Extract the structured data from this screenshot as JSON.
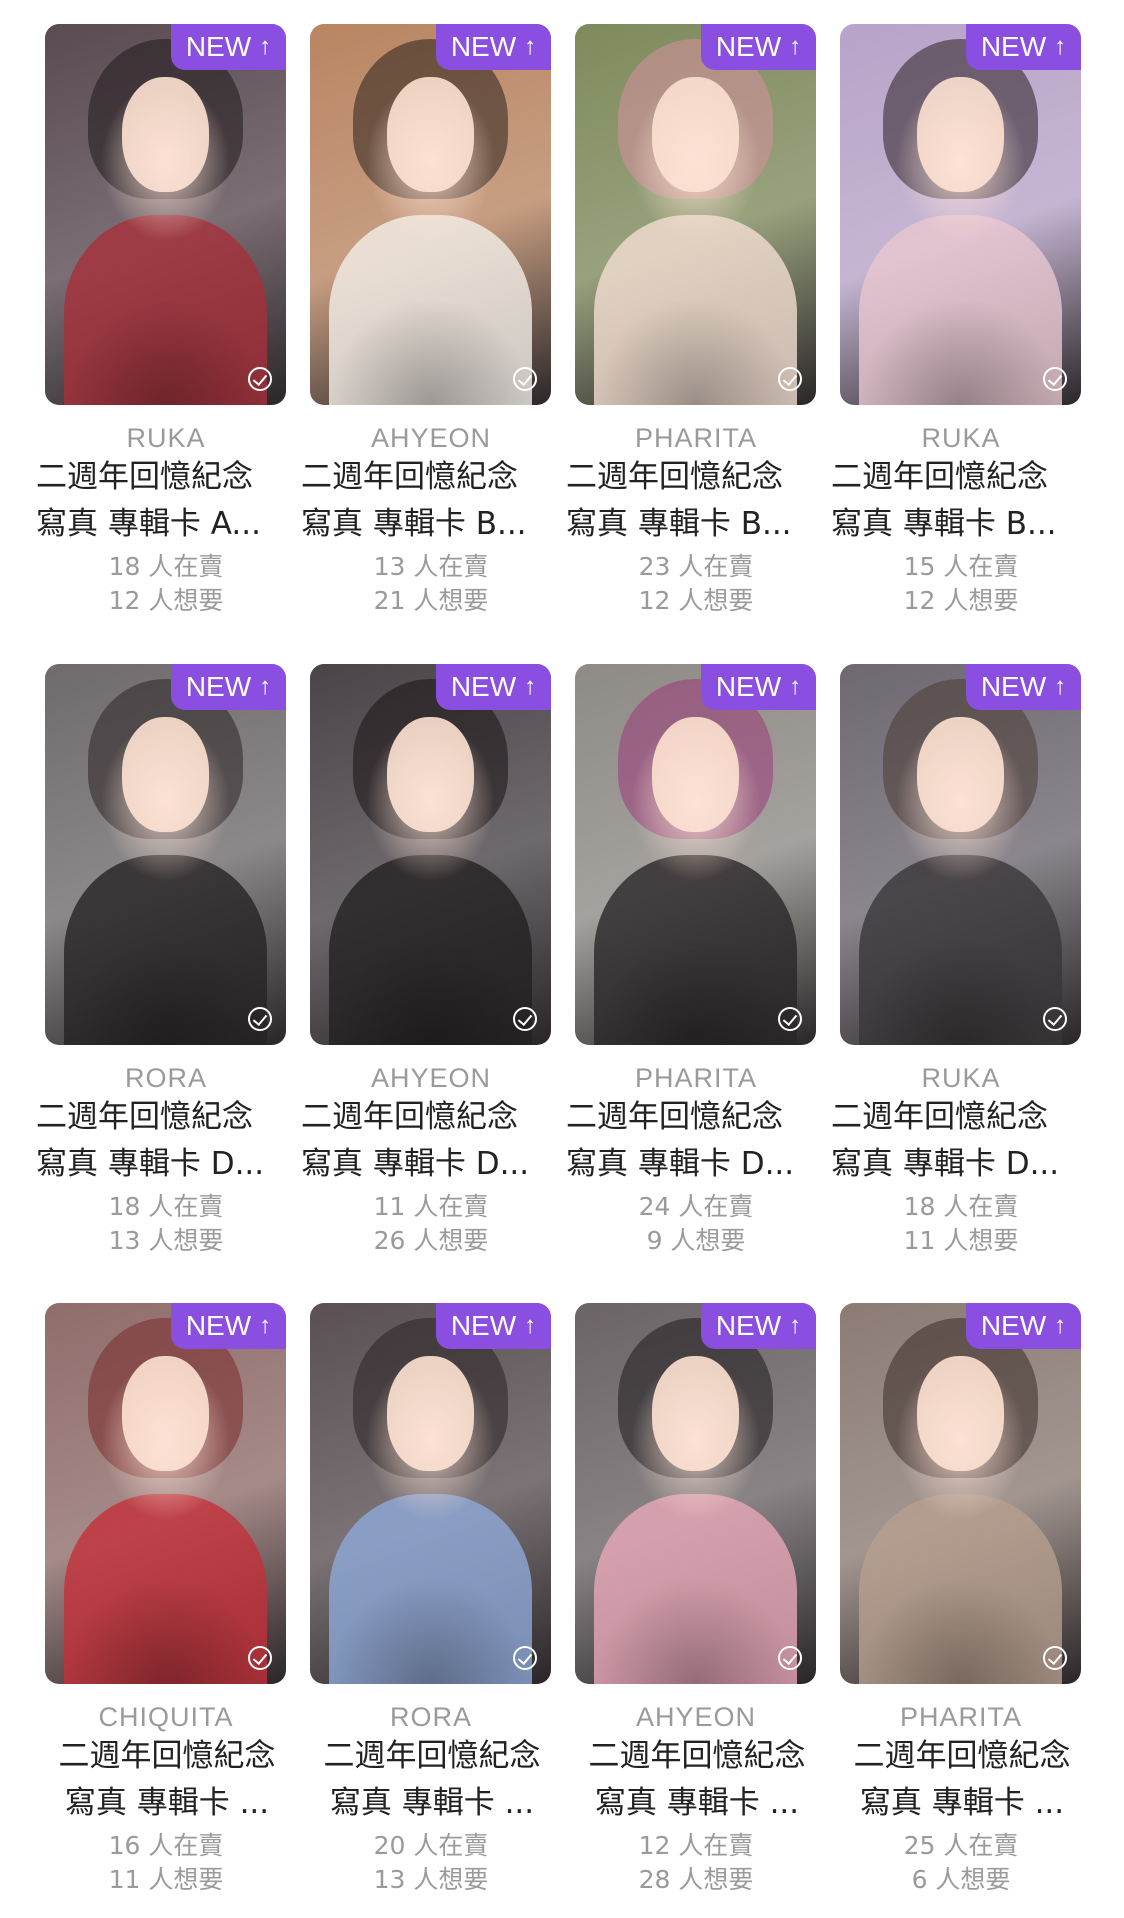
{
  "badge_label": "NEW",
  "colors": {
    "badge": "#8a4fe0",
    "title_text": "#222222",
    "muted_text": "#9a9a9a"
  },
  "cards": [
    {
      "member": "RUKA",
      "title_line1": "二週年回憶紀念",
      "title_line2": "寫真 專輯卡 A...",
      "selling": "18 人在賣",
      "wanting": "12 人想要",
      "palette": {
        "bg": "#5a4a52",
        "hair": "#1f1a1c",
        "body": "#a8303a"
      }
    },
    {
      "member": "AHYEON",
      "title_line1": "二週年回憶紀念",
      "title_line2": "寫真 專輯卡 B...",
      "selling": "13 人在賣",
      "wanting": "21 人想要",
      "palette": {
        "bg": "#b98562",
        "hair": "#2a201c",
        "body": "#f2efe9"
      }
    },
    {
      "member": "PHARITA",
      "title_line1": "二週年回憶紀念",
      "title_line2": "寫真 專輯卡 B...",
      "selling": "23 人在賣",
      "wanting": "12 人想要",
      "palette": {
        "bg": "#7e8a5c",
        "hair": "#d7909e",
        "body": "#f3ddd2"
      }
    },
    {
      "member": "RUKA",
      "title_line1": "二週年回憶紀念",
      "title_line2": "寫真 專輯卡 B...",
      "selling": "15 人在賣",
      "wanting": "12 人想要",
      "palette": {
        "bg": "#b7a3c8",
        "hair": "#2a1f22",
        "body": "#e9c7cf"
      }
    },
    {
      "member": "RORA",
      "title_line1": "二週年回憶紀念",
      "title_line2": "寫真 專輯卡 D...",
      "selling": "18 人在賣",
      "wanting": "13 人想要",
      "palette": {
        "bg": "#6f6b6c",
        "hair": "#2c2527",
        "body": "#262324"
      }
    },
    {
      "member": "AHYEON",
      "title_line1": "二週年回憶紀念",
      "title_line2": "寫真 專輯卡 D...",
      "selling": "11 人在賣",
      "wanting": "26 人想要",
      "palette": {
        "bg": "#4a4448",
        "hair": "#171314",
        "body": "#232022"
      }
    },
    {
      "member": "PHARITA",
      "title_line1": "二週年回憶紀念",
      "title_line2": "寫真 專輯卡 D...",
      "selling": "24 人在賣",
      "wanting": "9 人想要",
      "palette": {
        "bg": "#8e8a86",
        "hair": "#9b3a78",
        "body": "#2b2628"
      }
    },
    {
      "member": "RUKA",
      "title_line1": "二週年回憶紀念",
      "title_line2": "寫真 專輯卡 D...",
      "selling": "18 人在賣",
      "wanting": "11 人想要",
      "palette": {
        "bg": "#6e6870",
        "hair": "#4a3a34",
        "body": "#3a3638"
      }
    },
    {
      "member": "CHIQUITA",
      "title_line1": "二週年回憶紀念",
      "title_line2": "寫真 專輯卡 ...",
      "selling": "16 人在賣",
      "wanting": "11 人想要",
      "palette": {
        "bg": "#8f6d6b",
        "hair": "#7a2a2c",
        "body": "#c4303a"
      }
    },
    {
      "member": "RORA",
      "title_line1": "二週年回憶紀念",
      "title_line2": "寫真 專輯卡 ...",
      "selling": "20 人在賣",
      "wanting": "13 人想要",
      "palette": {
        "bg": "#5a5053",
        "hair": "#2a2224",
        "body": "#8fa9d8"
      }
    },
    {
      "member": "AHYEON",
      "title_line1": "二週年回憶紀念",
      "title_line2": "寫真 專輯卡 ...",
      "selling": "12 人在賣",
      "wanting": "28 人想要",
      "palette": {
        "bg": "#6b6466",
        "hair": "#1e1a1b",
        "body": "#e8a8b8"
      }
    },
    {
      "member": "PHARITA",
      "title_line1": "二週年回憶紀念",
      "title_line2": "寫真 專輯卡 ...",
      "selling": "25 人在賣",
      "wanting": "6 人想要",
      "palette": {
        "bg": "#8b7b74",
        "hair": "#3a2c28",
        "body": "#b69f8e"
      }
    }
  ]
}
